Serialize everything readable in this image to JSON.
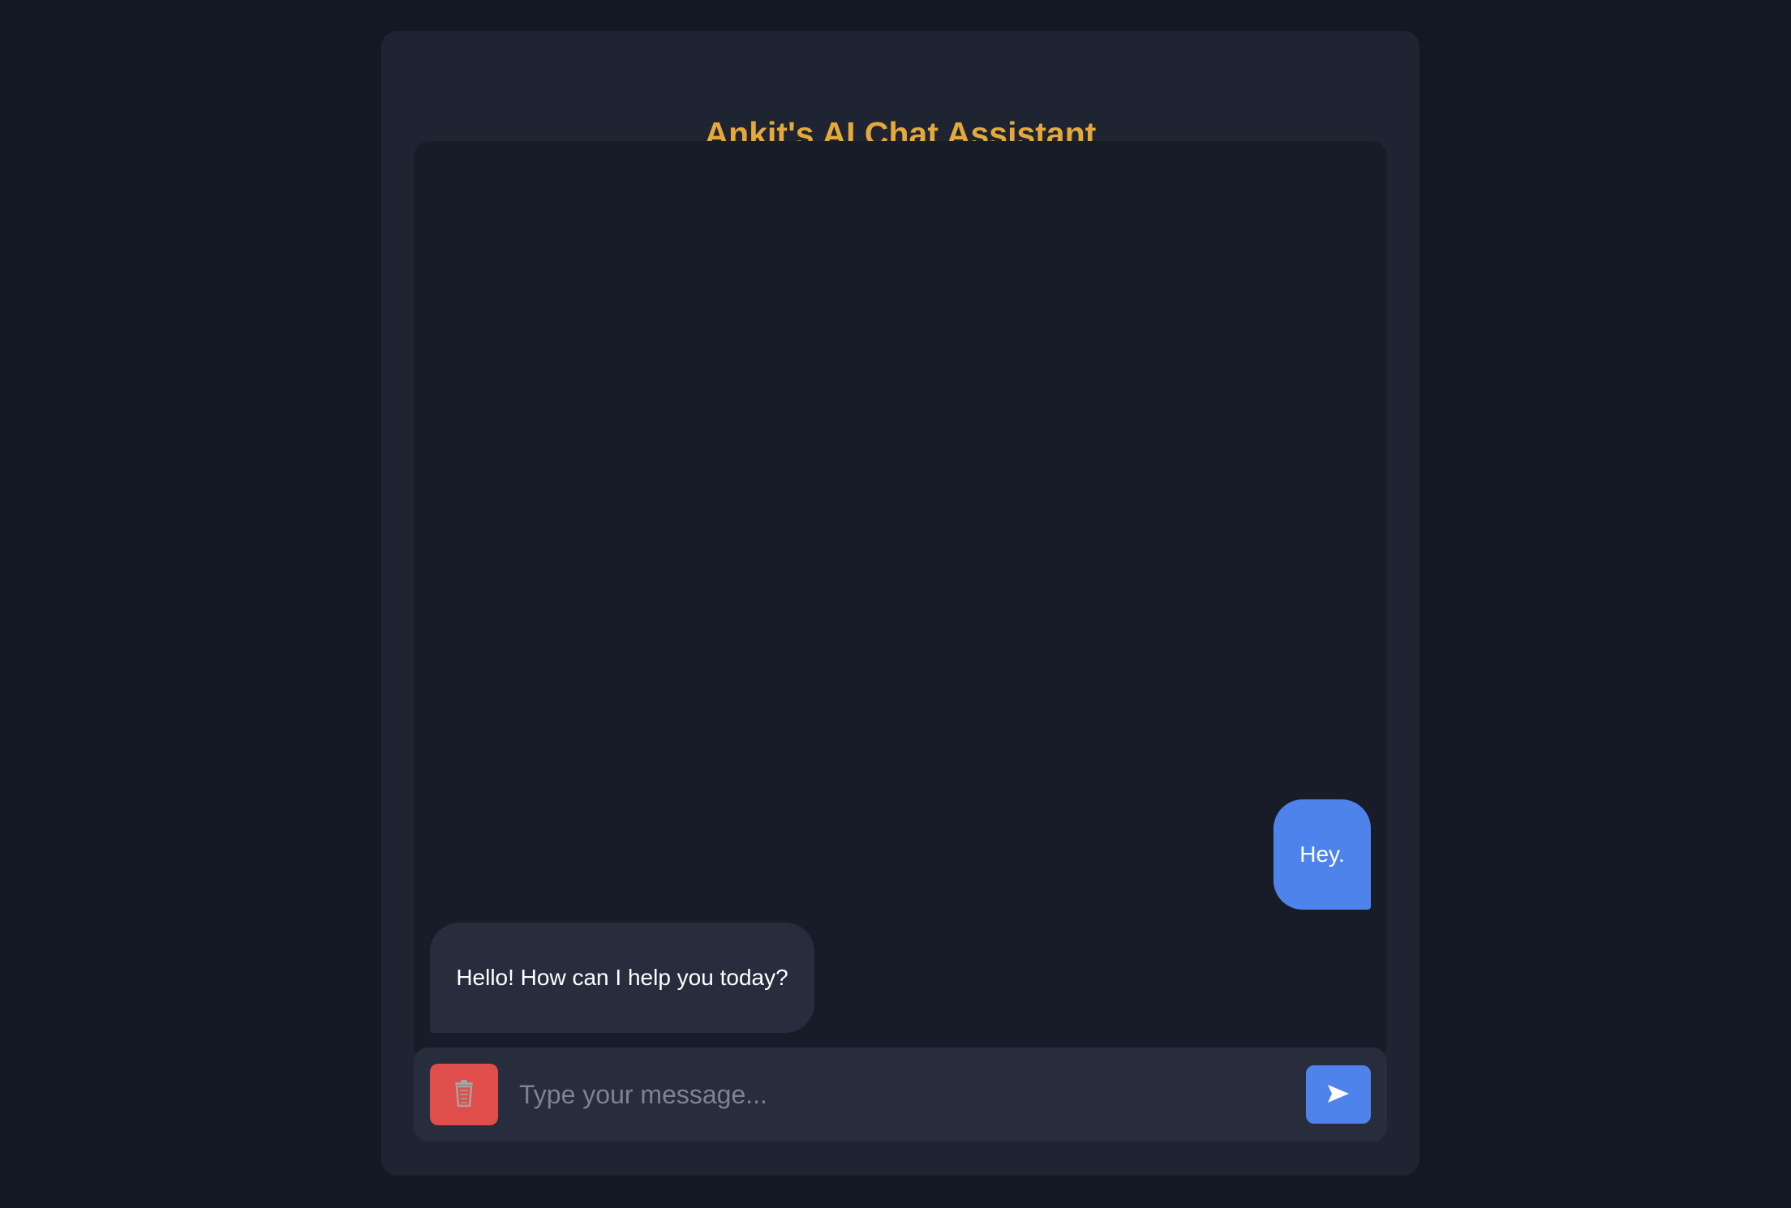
{
  "app": {
    "title": "Ankit's AI Chat Assistant"
  },
  "messages": [
    {
      "role": "user",
      "text": "Hey."
    },
    {
      "role": "assistant",
      "text": "Hello! How can I help you today?"
    }
  ],
  "input": {
    "placeholder": "Type your message...",
    "value": ""
  },
  "buttons": {
    "clear_icon": "trash-icon",
    "send_icon": "send-arrow-icon"
  },
  "colors": {
    "page_background": "#131825",
    "panel_background": "#1f2433",
    "chat_background": "#171c28",
    "title": "#e4a93b",
    "user_bubble": "#4f83ec",
    "assistant_bubble": "#272d3d",
    "clear_button": "#df4e4b",
    "send_button": "#4f83ec"
  }
}
